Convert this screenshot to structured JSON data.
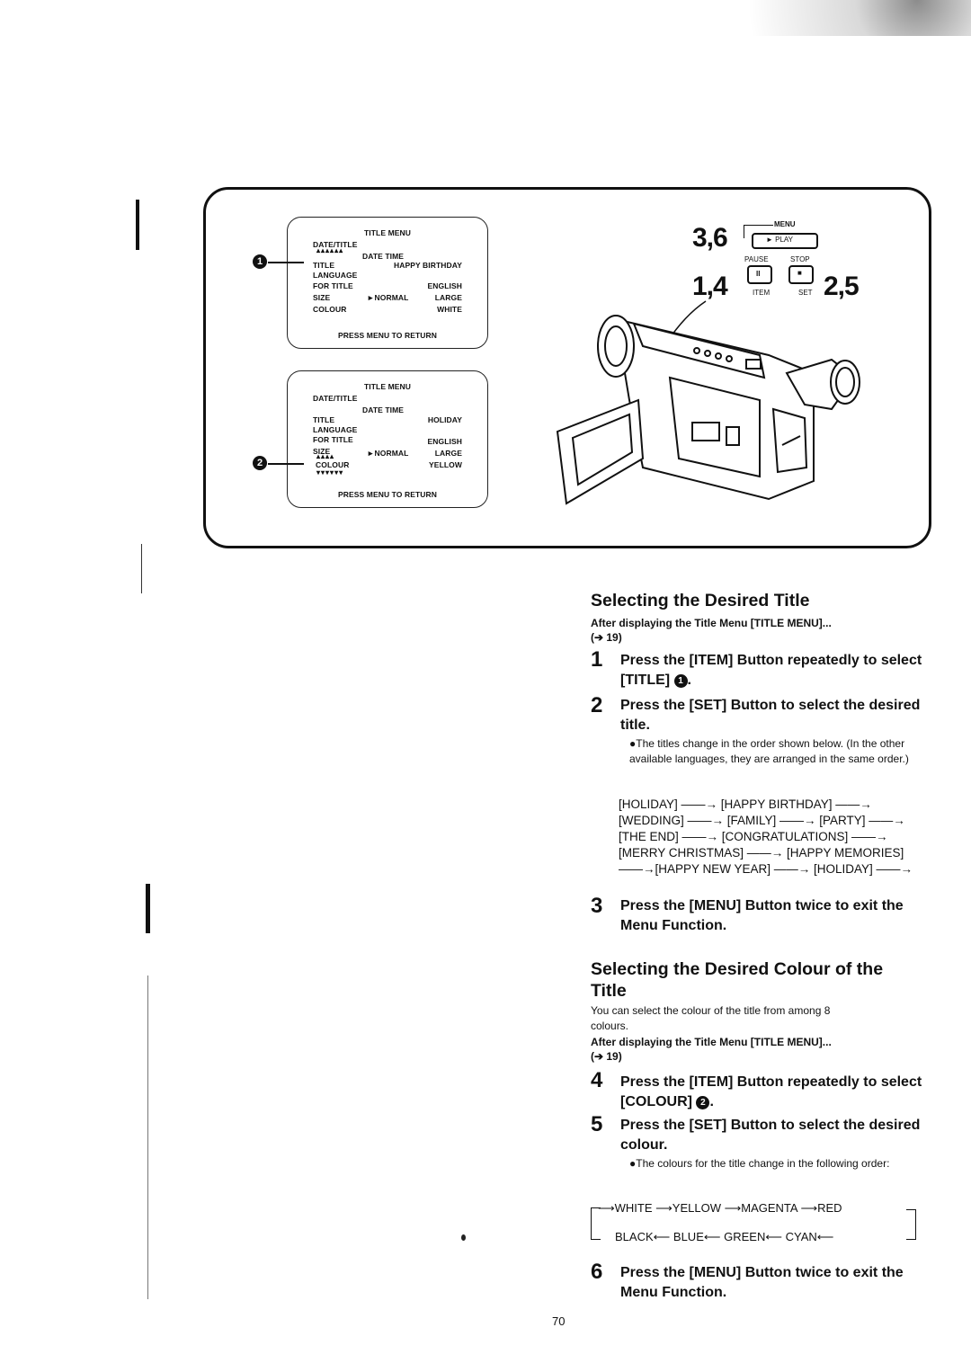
{
  "figure": {
    "screen1": {
      "title": "TITLE MENU",
      "rows": [
        {
          "label": "DATE/TITLE",
          "value": ""
        },
        {
          "label": "DATE  TIME",
          "value": ""
        },
        {
          "label": "TITLE",
          "value": "HAPPY BIRTHDAY"
        },
        {
          "label": "LANGUAGE",
          "value": ""
        },
        {
          "label": "FOR TITLE",
          "value": "ENGLISH"
        },
        {
          "label": "SIZE",
          "option_selected": "►NORMAL",
          "value": "LARGE"
        },
        {
          "label": "COLOUR",
          "value": "WHITE"
        }
      ],
      "footer": "PRESS MENU TO RETURN",
      "callout": "1"
    },
    "screen2": {
      "title": "TITLE MENU",
      "rows": [
        {
          "label": "DATE/TITLE",
          "value": ""
        },
        {
          "label": "DATE  TIME",
          "value": ""
        },
        {
          "label": "TITLE",
          "value": "HOLIDAY"
        },
        {
          "label": "LANGUAGE",
          "value": ""
        },
        {
          "label": "FOR TITLE",
          "value": "ENGLISH"
        },
        {
          "label": "SIZE",
          "option_selected": "►NORMAL",
          "value": "LARGE"
        },
        {
          "label": "COLOUR",
          "value": "YELLOW"
        }
      ],
      "footer": "PRESS MENU TO RETURN",
      "callout": "2"
    },
    "buttons": {
      "steps_menu": "3,6",
      "steps_item": "1,4",
      "steps_set": "2,5",
      "menu_label": "MENU",
      "play_label": "► PLAY",
      "pause_label": "PAUSE",
      "stop_label": "STOP",
      "item_label": "ITEM",
      "set_label": "SET",
      "pause_glyph": "II",
      "stop_glyph": "■"
    },
    "camcorder_icon": "camcorder-illustration"
  },
  "section1": {
    "heading": "Selecting the Desired Title",
    "prereq": "After displaying the Title Menu [TITLE MENU]...",
    "prereq_ref": "(➔ 19)",
    "steps": [
      {
        "num": "1",
        "text": "Press the [ITEM] Button repeatedly to select [TITLE]",
        "callout": "1"
      },
      {
        "num": "2",
        "text": "Press the [SET] Button to select the desired title."
      },
      {
        "num": "3",
        "text": "Press the [MENU] Button twice to exit the Menu Function."
      }
    ],
    "note": "●The titles change in the order shown below. (In the other available languages, they are arranged in the same order.)",
    "title_sequence_lines": [
      "[HOLIDAY] ——→ [HAPPY BIRTHDAY] ——→",
      "[WEDDING] ——→ [FAMILY] ——→ [PARTY] ——→",
      "[THE END] ——→ [CONGRATULATIONS] ——→",
      "[MERRY CHRISTMAS] ——→ [HAPPY MEMORIES]",
      "——→[HAPPY NEW YEAR] ——→ [HOLIDAY] ——→"
    ]
  },
  "section2": {
    "heading_line1": "Selecting the Desired Colour of the",
    "heading_line2": "Title",
    "intro_line1": "You can select the colour of the title from among 8",
    "intro_line2": "colours.",
    "prereq": "After displaying the Title Menu [TITLE MENU]...",
    "prereq_ref": "(➔ 19)",
    "steps": [
      {
        "num": "4",
        "text": "Press the [ITEM] Button repeatedly to select [COLOUR]",
        "callout": "2"
      },
      {
        "num": "5",
        "text": "Press the [SET] Button to select the desired colour."
      },
      {
        "num": "6",
        "text": "Press the [MENU] Button twice to exit the Menu Function."
      }
    ],
    "note": "●The colours for the title change in the following order:",
    "colour_cycle_top": [
      "WHITE",
      "YELLOW",
      "MAGENTA",
      "RED"
    ],
    "colour_cycle_bottom": [
      "BLACK",
      "BLUE",
      "GREEN",
      "CYAN"
    ]
  },
  "page_number": "70"
}
